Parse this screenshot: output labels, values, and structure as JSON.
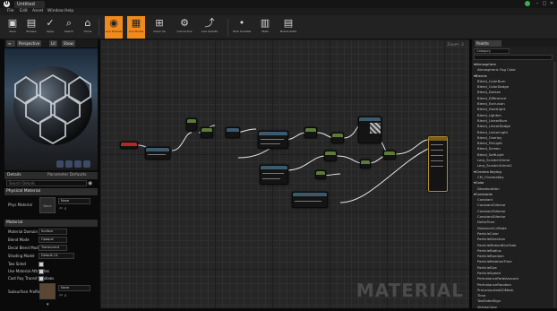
{
  "titlebar": {
    "tab_title": "Untitled",
    "logo_letter": "U"
  },
  "menubar": {
    "items": [
      "File",
      "Edit",
      "Asset",
      "Window",
      "Help"
    ]
  },
  "toolbar": {
    "buttons": [
      {
        "label": "Save",
        "icon": "save-icon"
      },
      {
        "label": "Browse",
        "icon": "browse-icon"
      },
      {
        "label": "Apply",
        "icon": "apply-icon"
      },
      {
        "label": "Search",
        "icon": "search-icon"
      },
      {
        "label": "Home",
        "icon": "home-icon"
      },
      {
        "label": "Clean Up",
        "icon": "clean-up-icon"
      },
      {
        "label": "Connectors",
        "icon": "connectors-icon"
      },
      {
        "label": "Live Preview",
        "icon": "live-preview-icon",
        "active": true
      },
      {
        "label": "Live Nodes",
        "icon": "live-nodes-icon",
        "active": true
      },
      {
        "label": "Live Update",
        "icon": "live-update-icon"
      },
      {
        "label": "Hide Unrelated",
        "icon": "hide-unrelated-icon"
      },
      {
        "label": "Stats",
        "icon": "stats-icon"
      },
      {
        "label": "Mobile Stats",
        "icon": "mobile-stats-icon"
      }
    ]
  },
  "viewport_tabs": {
    "perspective": "Perspective",
    "lit": "Lit",
    "show": "Show"
  },
  "details": {
    "title": "Details",
    "tab2": "Parameter Defaults",
    "search_placeholder": "Search Details",
    "physical_section": "Physical Material",
    "phys_mat_label": "Phys Material",
    "phys_mat_value": "None",
    "phys_mat_swatch": "None",
    "material_section": "Material",
    "props": [
      {
        "label": "Material Domain",
        "value": "Surface"
      },
      {
        "label": "Blend Mode",
        "value": "Opaque"
      },
      {
        "label": "Decal Blend Mode",
        "value": "Translucent"
      },
      {
        "label": "Shading Model",
        "value": "Default Lit"
      }
    ],
    "checks": [
      {
        "label": "Two Sided"
      },
      {
        "label": "Use Material Attributes"
      },
      {
        "label": "Cast Ray Traced Shadows"
      }
    ],
    "subsurface_label": "Subsurface Profile",
    "subsurface_value": "None"
  },
  "graph": {
    "zoom": "Zoom -2",
    "watermark": "MATERIAL"
  },
  "palette": {
    "tab": "Palette",
    "category": "Category",
    "items": [
      {
        "text": "Atmosphere",
        "cat": true
      },
      {
        "text": "Atmospheric Fog Color",
        "cat": false
      },
      {
        "text": "Blends",
        "cat": true
      },
      {
        "text": "Blend_ColorBurn",
        "cat": false
      },
      {
        "text": "Blend_ColorDodge",
        "cat": false
      },
      {
        "text": "Blend_Darken",
        "cat": false
      },
      {
        "text": "Blend_Difference",
        "cat": false
      },
      {
        "text": "Blend_Exclusion",
        "cat": false
      },
      {
        "text": "Blend_HardLight",
        "cat": false
      },
      {
        "text": "Blend_Lighten",
        "cat": false
      },
      {
        "text": "Blend_LinearBurn",
        "cat": false
      },
      {
        "text": "Blend_LinearDodge",
        "cat": false
      },
      {
        "text": "Blend_LinearLight",
        "cat": false
      },
      {
        "text": "Blend_Overlay",
        "cat": false
      },
      {
        "text": "Blend_PinLight",
        "cat": false
      },
      {
        "text": "Blend_Screen",
        "cat": false
      },
      {
        "text": "Blend_SoftLight",
        "cat": false
      },
      {
        "text": "Lerp_ScratchGrime",
        "cat": false
      },
      {
        "text": "Lerp_ScratchGrime2",
        "cat": false
      },
      {
        "text": "Chroma Keying",
        "cat": true
      },
      {
        "text": "CM_ChromaKey",
        "cat": false
      },
      {
        "text": "Color",
        "cat": true
      },
      {
        "text": "Desaturation",
        "cat": false
      },
      {
        "text": "Constants",
        "cat": true
      },
      {
        "text": "Constant",
        "cat": false
      },
      {
        "text": "Constant2Vector",
        "cat": false
      },
      {
        "text": "Constant3Vector",
        "cat": false
      },
      {
        "text": "Constant4Vector",
        "cat": false
      },
      {
        "text": "DeltaTime",
        "cat": false
      },
      {
        "text": "DistanceCullFade",
        "cat": false
      },
      {
        "text": "ParticleColor",
        "cat": false
      },
      {
        "text": "ParticleDirection",
        "cat": false
      },
      {
        "text": "ParticleMotionBlurFade",
        "cat": false
      },
      {
        "text": "ParticleRadius",
        "cat": false
      },
      {
        "text": "ParticleRandom",
        "cat": false
      },
      {
        "text": "ParticleRelativeTime",
        "cat": false
      },
      {
        "text": "ParticleSize",
        "cat": false
      },
      {
        "text": "ParticleSpeed",
        "cat": false
      },
      {
        "text": "PerInstanceFadeAmount",
        "cat": false
      },
      {
        "text": "PerInstanceRandom",
        "cat": false
      },
      {
        "text": "PrecomputedAOMask",
        "cat": false
      },
      {
        "text": "Time",
        "cat": false
      },
      {
        "text": "TwoSidedSign",
        "cat": false
      },
      {
        "text": "VertexColor",
        "cat": false
      },
      {
        "text": "ViewProperty",
        "cat": false
      }
    ]
  }
}
